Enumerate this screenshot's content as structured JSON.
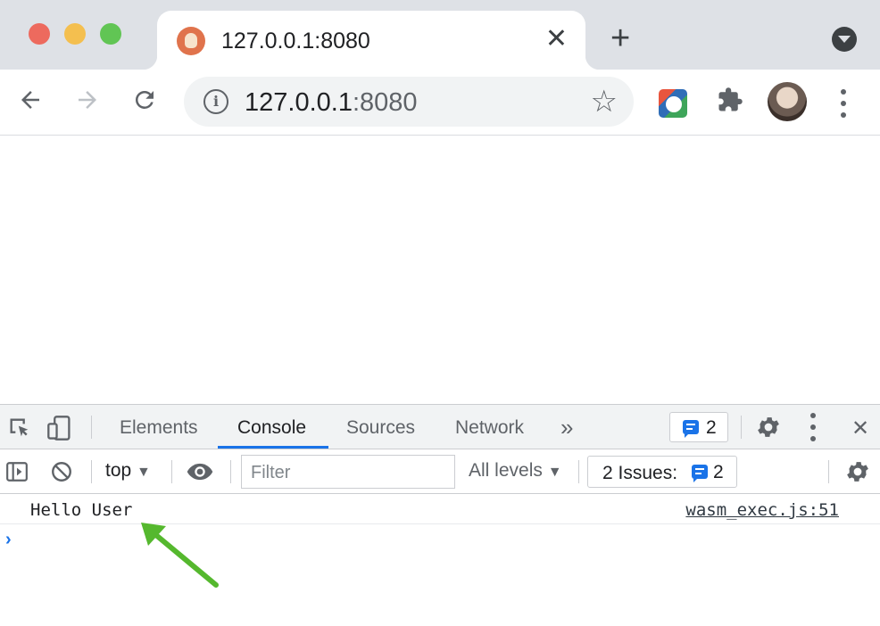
{
  "browser": {
    "tab": {
      "title": "127.0.0.1:8080",
      "close_glyph": "✕"
    },
    "new_tab_glyph": "+",
    "address": {
      "host": "127.0.0.1",
      "port": ":8080"
    },
    "icons": {
      "back": "back-arrow-icon",
      "forward": "forward-arrow-icon",
      "reload": "reload-icon",
      "info": "info-icon",
      "star": "bookmark-star-icon",
      "extension": "extension-icon",
      "puzzle": "extensions-puzzle-icon",
      "menu": "more-vert-icon"
    },
    "info_glyph": "i",
    "star_glyph": "☆"
  },
  "devtools": {
    "tabs": [
      {
        "label": "Elements"
      },
      {
        "label": "Console"
      },
      {
        "label": "Sources"
      },
      {
        "label": "Network"
      }
    ],
    "more_tabs_glyph": "»",
    "message_count": "2",
    "close_glyph": "✕",
    "console": {
      "context": "top",
      "filter_placeholder": "Filter",
      "levels": "All levels",
      "issues_label": "2 Issues:",
      "issues_count": "2",
      "messages": [
        {
          "text": "Hello User",
          "source": "wasm_exec.js:51"
        }
      ],
      "prompt_glyph": "›"
    }
  },
  "colors": {
    "accent": "#1a73e8",
    "annotation_arrow": "#55b82e"
  }
}
